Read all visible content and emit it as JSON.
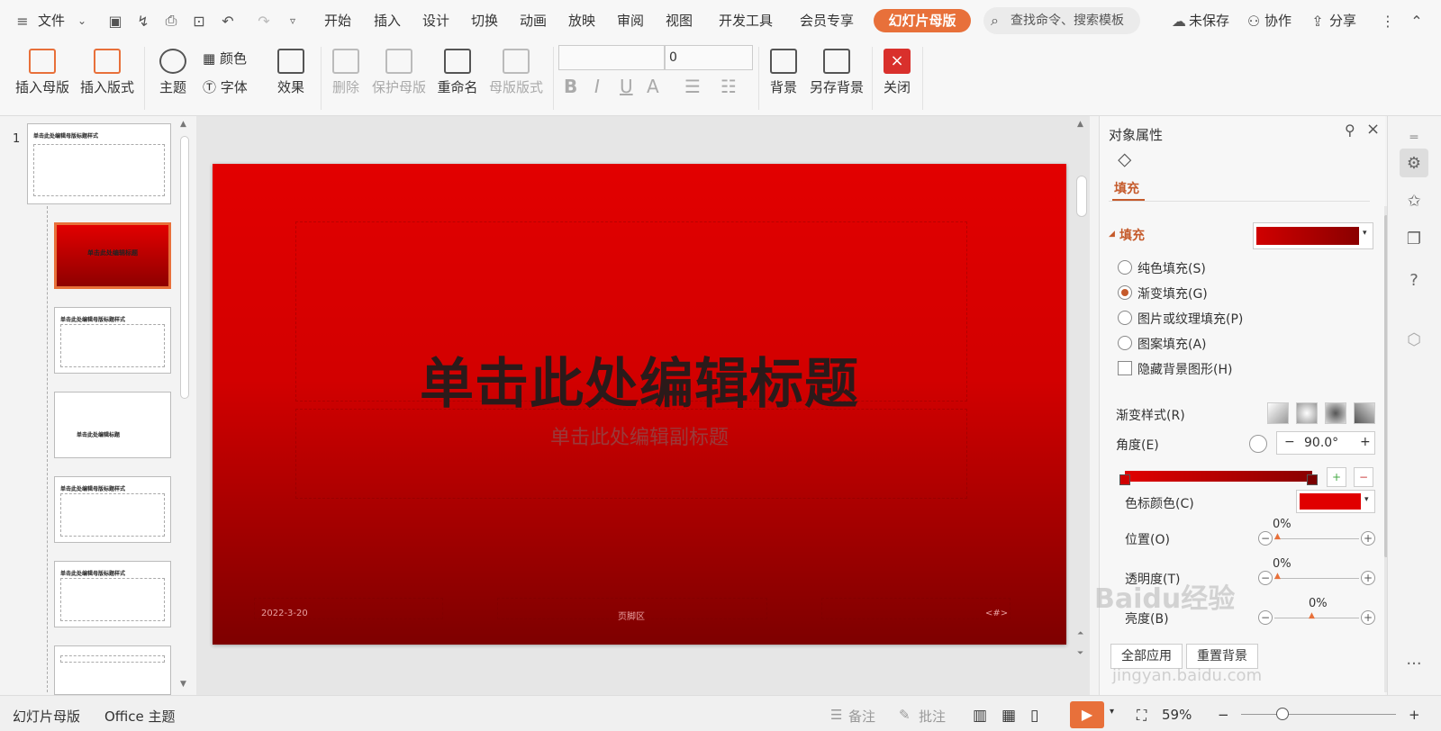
{
  "menu": {
    "file_label": "文件",
    "tabs": [
      "开始",
      "插入",
      "设计",
      "切换",
      "动画",
      "放映",
      "审阅",
      "视图",
      "开发工具",
      "会员专享"
    ],
    "active_tab": "幻灯片母版",
    "search_placeholder": "查找命令、搜索模板",
    "unsaved_label": "未保存",
    "collab_label": "协作",
    "share_label": "分享"
  },
  "ribbon": {
    "insert_master": "插入母版",
    "insert_layout": "插入版式",
    "theme": "主题",
    "colors": "颜色",
    "fonts": "字体",
    "effects": "效果",
    "delete": "删除",
    "protect_master": "保护母版",
    "rename": "重命名",
    "master_layout": "母版版式",
    "font_size_value": "0",
    "background": "背景",
    "save_background": "另存背景",
    "close": "关闭"
  },
  "thumbnails": {
    "slide_number": "1",
    "master_title": "单击此处编辑母版标题样式",
    "layout_title": "单击此处编辑标题",
    "content_title": "单击此处编辑母版标题样式",
    "section_title": "单击此处编辑标题"
  },
  "slide": {
    "title": "单击此处编辑标题",
    "subtitle": "单击此处编辑副标题",
    "footer_date": "2022-3-20",
    "footer_text": "页脚区",
    "footer_number": "<#>"
  },
  "properties": {
    "panel_title": "对象属性",
    "tab_fill": "填充",
    "section_fill": "填充",
    "opt_solid": "纯色填充(S)",
    "opt_gradient": "渐变填充(G)",
    "opt_picture": "图片或纹理填充(P)",
    "opt_pattern": "图案填充(A)",
    "opt_hide_bg": "隐藏背景图形(H)",
    "gradient_style": "渐变样式(R)",
    "angle_label": "角度(E)",
    "angle_value": "90.0°",
    "stop_color": "色标颜色(C)",
    "position_label": "位置(O)",
    "position_value": "0%",
    "transparency_label": "透明度(T)",
    "transparency_value": "0%",
    "brightness_label": "亮度(B)",
    "brightness_value": "0%",
    "apply_all": "全部应用",
    "reset_bg": "重置背景",
    "fill_color": "#cc0000",
    "stop_color_value": "#e00000"
  },
  "status": {
    "mode": "幻灯片母版",
    "theme": "Office 主题",
    "notes": "备注",
    "comments": "批注",
    "zoom": "59%"
  },
  "watermark": {
    "brand": "Baidu经验",
    "url": "jingyan.baidu.com"
  },
  "colors": {
    "accent": "#e8703a",
    "slide_top": "#e20000",
    "slide_bottom": "#7e0000"
  }
}
